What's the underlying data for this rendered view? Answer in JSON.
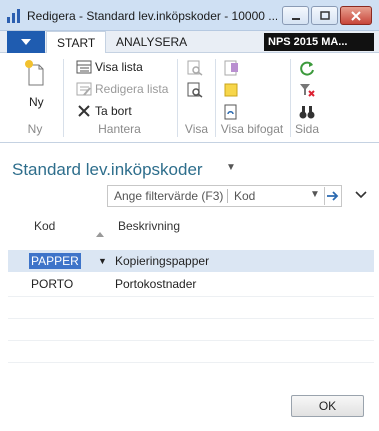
{
  "window": {
    "title": "Redigera - Standard lev.inköpskoder - 10000 ...",
    "controls": [
      "minimize",
      "maximize",
      "close"
    ]
  },
  "ribbon": {
    "tabs": [
      {
        "label": "START",
        "active": true
      },
      {
        "label": "ANALYSERA",
        "active": false
      }
    ],
    "company": "NPS 2015 MA...",
    "groups": {
      "ny": {
        "label": "Ny",
        "new_label": "Ny"
      },
      "hantera": {
        "label": "Hantera",
        "visa_lista": "Visa lista",
        "redigera_lista": "Redigera lista",
        "ta_bort": "Ta bort"
      },
      "visa": {
        "label": "Visa"
      },
      "visa_bifogat": {
        "label": "Visa bifogat"
      },
      "sida": {
        "label": "Sida"
      }
    }
  },
  "page": {
    "title": "Standard lev.inköpskoder",
    "filter": {
      "placeholder": "Ange filtervärde (F3)",
      "field": "Kod"
    },
    "columns": {
      "kod": "Kod",
      "beskrivning": "Beskrivning"
    },
    "rows": [
      {
        "kod": "PAPPER",
        "beskrivning": "Kopieringspapper",
        "selected": true
      },
      {
        "kod": "PORTO",
        "beskrivning": "Portokostnader",
        "selected": false
      }
    ]
  },
  "footer": {
    "ok_label": "OK"
  },
  "colors": {
    "accent": "#1f5cb0",
    "title": "#2e6e8c",
    "selection": "#3e74c9"
  }
}
